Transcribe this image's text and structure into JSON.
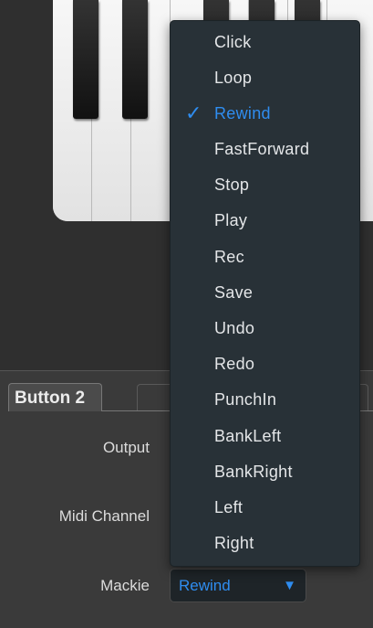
{
  "section": {
    "tab_label": "Button 2"
  },
  "fields": {
    "output_label": "Output",
    "midi_channel_label": "Midi Channel",
    "mackie_label": "Mackie",
    "mackie_value": "Rewind"
  },
  "menu": {
    "checkmark": "✓",
    "items": [
      {
        "label": "Click"
      },
      {
        "label": "Loop"
      },
      {
        "label": "Rewind",
        "selected": true
      },
      {
        "label": "FastForward"
      },
      {
        "label": "Stop"
      },
      {
        "label": "Play"
      },
      {
        "label": "Rec"
      },
      {
        "label": "Save"
      },
      {
        "label": "Undo"
      },
      {
        "label": "Redo"
      },
      {
        "label": "PunchIn"
      },
      {
        "label": "BankLeft"
      },
      {
        "label": "BankRight"
      },
      {
        "label": "Left"
      },
      {
        "label": "Right"
      }
    ]
  },
  "colors": {
    "accent": "#2f8df0",
    "menu_bg": "#283137",
    "panel_bg": "#2f2f2f"
  }
}
